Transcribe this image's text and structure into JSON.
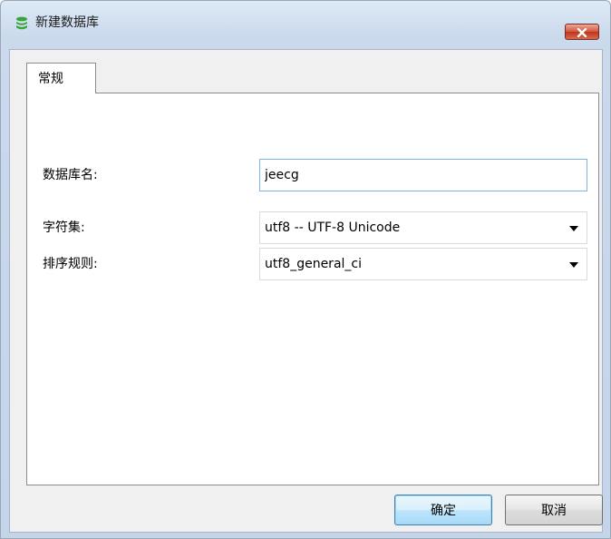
{
  "window": {
    "title": "新建数据库",
    "icon": "database-icon",
    "close_icon": "close-icon"
  },
  "tabs": [
    {
      "label": "常规",
      "active": true
    }
  ],
  "form": {
    "db_name_label": "数据库名:",
    "db_name_value": "jeecg",
    "charset_label": "字符集:",
    "charset_value": "utf8 -- UTF-8 Unicode",
    "collation_label": "排序规则:",
    "collation_value": "utf8_general_ci"
  },
  "buttons": {
    "ok_label": "确定",
    "cancel_label": "取消"
  },
  "colors": {
    "title_icon": "#3aa33a",
    "close_button": "#c7432a",
    "focus_border": "#7eb4ea"
  }
}
